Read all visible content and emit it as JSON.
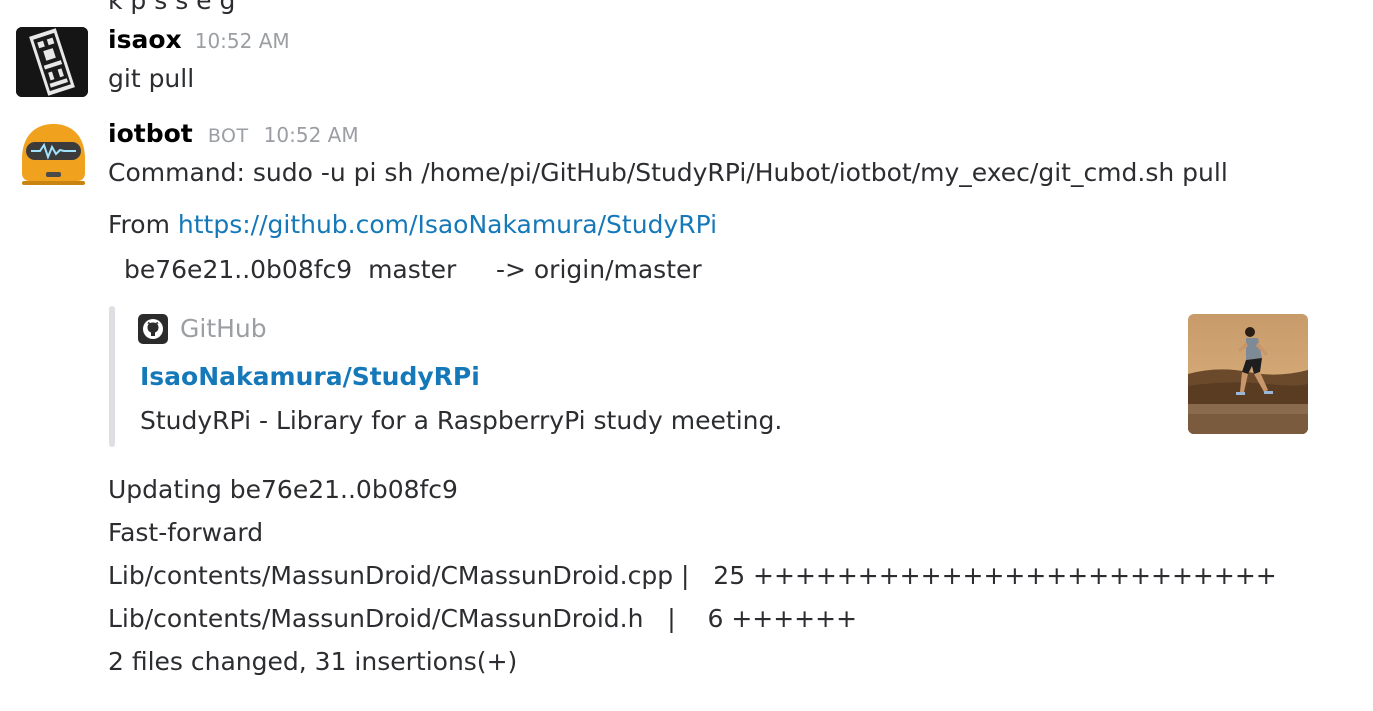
{
  "top_clipped_text": "k p s s e g",
  "messages": [
    {
      "author": "isaox",
      "time": "10:52 AM",
      "text": "git pull"
    },
    {
      "author": "iotbot",
      "badge": "BOT",
      "time": "10:52 AM",
      "command_line": "Command: sudo -u pi sh /home/pi/GitHub/StudyRPi/Hubot/iotbot/my_exec/git_cmd.sh pull",
      "from_prefix": "From ",
      "from_link": "https://github.com/IsaoNakamura/StudyRPi",
      "branch_line": "be76e21..0b08fc9  master     -> origin/master",
      "attachment": {
        "service_name": "GitHub",
        "title": "IsaoNakamura/StudyRPi",
        "description": "StudyRPi - Library for a RaspberryPi study meeting."
      },
      "output_lines": [
        "Updating be76e21..0b08fc9",
        "Fast-forward",
        "Lib/contents/MassunDroid/CMassunDroid.cpp |   25 +++++++++++++++++++++++++",
        "Lib/contents/MassunDroid/CMassunDroid.h   |    6 ++++++",
        "2 files changed, 31 insertions(+)"
      ]
    }
  ],
  "colors": {
    "link": "#1578b8",
    "muted": "#9b9ea3",
    "text": "#2c2d30",
    "attachment_bar": "#dfdfe3",
    "bot_avatar": "#f0a21e"
  },
  "icons": {
    "isaox_avatar": "pixel-art-avatar",
    "iotbot_avatar": "robot-pulse-avatar",
    "github": "github-octocat-icon",
    "thumbnail": "person-jumping-photo"
  }
}
